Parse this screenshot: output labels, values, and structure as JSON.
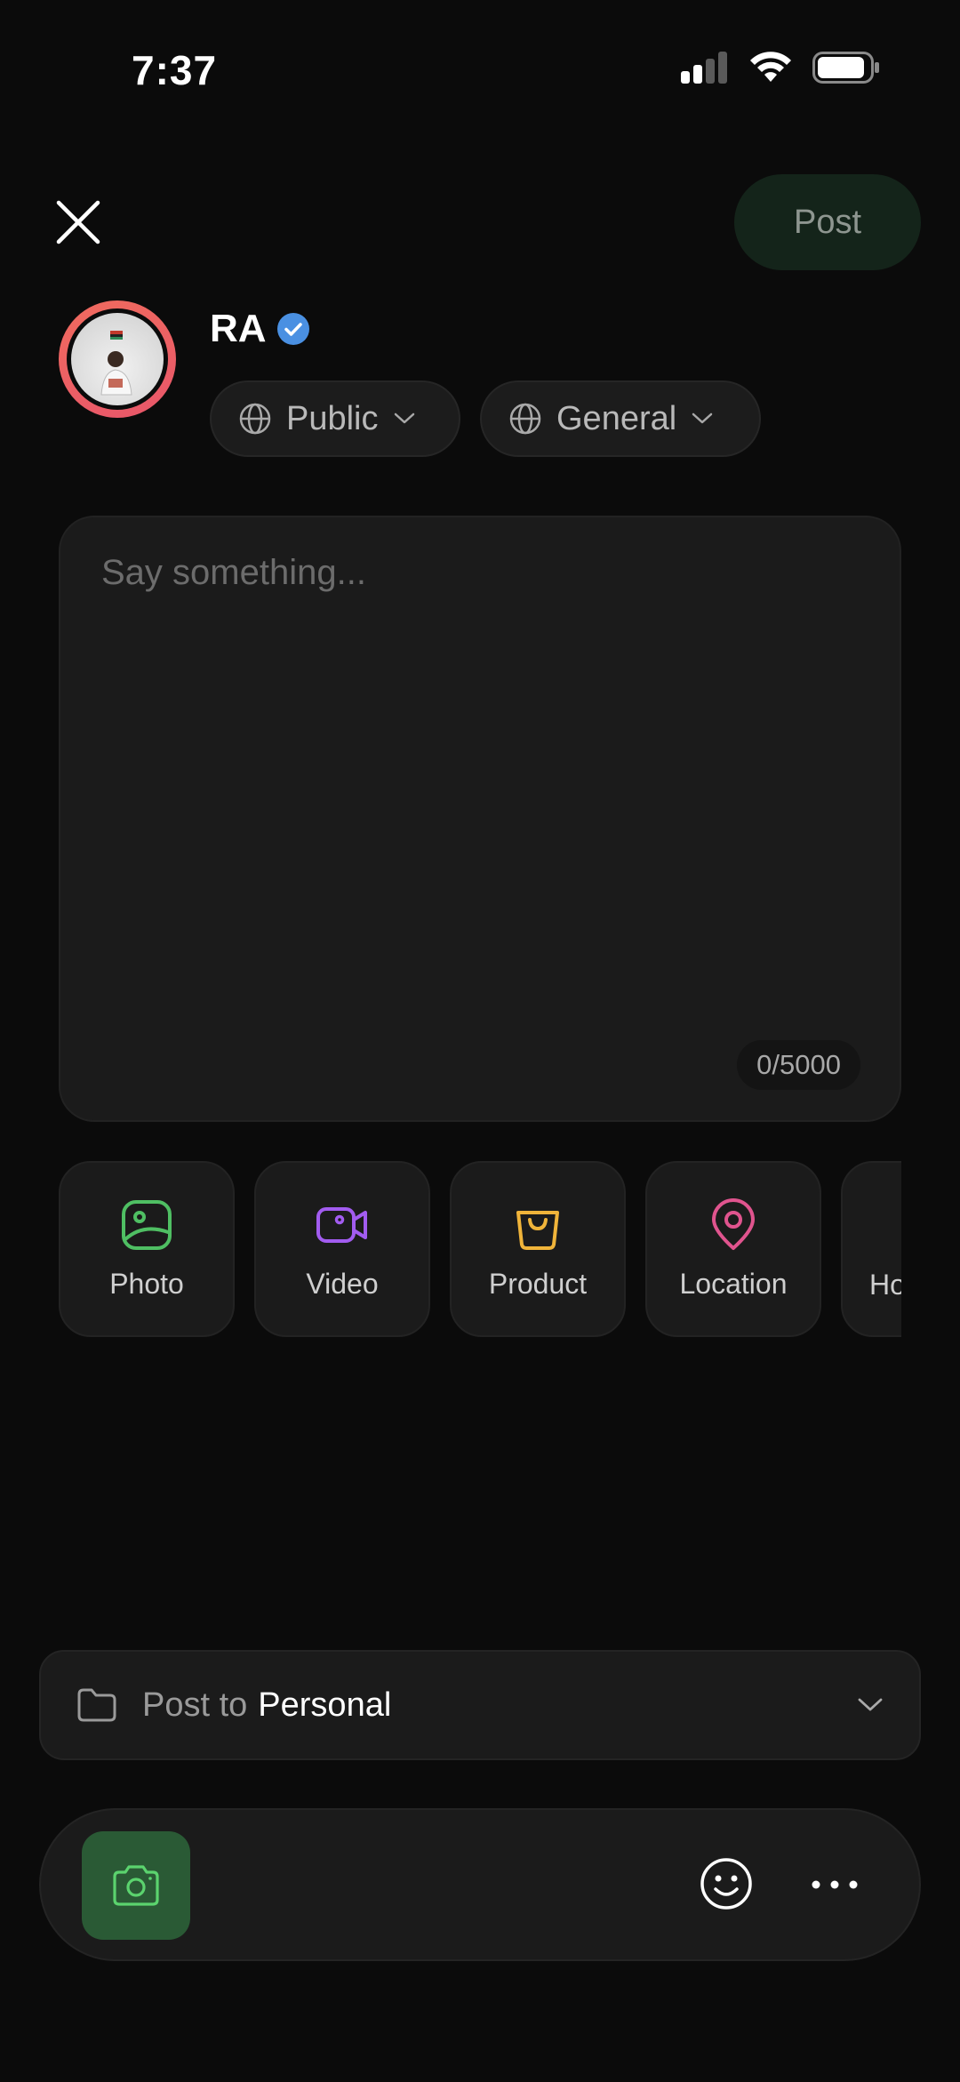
{
  "status_bar": {
    "time": "7:37",
    "icons": [
      "signal-icon",
      "wifi-icon",
      "battery-icon"
    ]
  },
  "header": {
    "close_icon": "close-icon",
    "post_label": "Post"
  },
  "profile": {
    "name": "RA",
    "verified_icon": "verified-badge-icon",
    "visibility": {
      "icon": "globe-icon",
      "label": "Public"
    },
    "category": {
      "icon": "globe-icon",
      "label": "General"
    }
  },
  "compose": {
    "placeholder": "Say something...",
    "value": "",
    "counter": "0/5000"
  },
  "attachments": [
    {
      "label": "Photo",
      "icon": "image-icon",
      "color": "#4fbf63"
    },
    {
      "label": "Video",
      "icon": "video-camera-icon",
      "color": "#a25cf0"
    },
    {
      "label": "Product",
      "icon": "shopping-bag-icon",
      "color": "#f0b43a"
    },
    {
      "label": "Location",
      "icon": "map-pin-icon",
      "color": "#e0548e"
    },
    {
      "label": "Ho",
      "icon": "",
      "color": "#cfcfcf"
    }
  ],
  "post_to": {
    "icon": "folder-icon",
    "prefix": "Post to",
    "target": "Personal"
  },
  "toolbar": {
    "camera_icon": "camera-icon",
    "emoji_icon": "smiley-icon",
    "more_icon": "more-horizontal-icon"
  },
  "colors": {
    "background": "#0b0b0b",
    "surface": "#1b1b1b",
    "accent_green": "#2a5a35",
    "post_button": "#14241a",
    "avatar_ring": "#f06b5e",
    "verified": "#4a90e2"
  }
}
